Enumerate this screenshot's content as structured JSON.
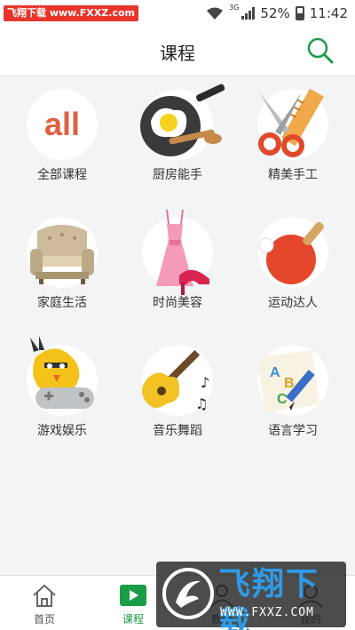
{
  "status_bar": {
    "watermark": "飞翔下载 www.FXXZ.com",
    "network": "3G",
    "battery": "52%",
    "time": "11:42"
  },
  "header": {
    "title": "课程",
    "search_icon": "search-icon"
  },
  "categories": [
    {
      "label": "全部课程",
      "icon": "all-courses-icon",
      "art_text": "all"
    },
    {
      "label": "厨房能手",
      "icon": "frying-pan-icon"
    },
    {
      "label": "精美手工",
      "icon": "scissors-ruler-icon"
    },
    {
      "label": "家庭生活",
      "icon": "sofa-icon"
    },
    {
      "label": "时尚美容",
      "icon": "dress-heels-icon"
    },
    {
      "label": "运动达人",
      "icon": "ping-pong-icon"
    },
    {
      "label": "游戏娱乐",
      "icon": "game-controller-icon"
    },
    {
      "label": "音乐舞蹈",
      "icon": "guitar-icon"
    },
    {
      "label": "语言学习",
      "icon": "abc-pencil-icon",
      "art_text": [
        "A",
        "B",
        "C"
      ]
    }
  ],
  "tabbar": {
    "tabs": [
      {
        "label": "首页",
        "icon": "home-icon",
        "active": false
      },
      {
        "label": "课程",
        "icon": "play-icon",
        "active": true
      },
      {
        "label": "教师",
        "icon": "teacher-icon",
        "active": false
      },
      {
        "label": "我的",
        "icon": "profile-icon",
        "active": false
      }
    ]
  },
  "watermark_overlay": {
    "text": "飞翔下载",
    "url": "WWW.FXXZ.COM"
  },
  "colors": {
    "accent": "#1a9d47",
    "watermark_red": "#e8352b",
    "background": "#f2f4f5"
  }
}
